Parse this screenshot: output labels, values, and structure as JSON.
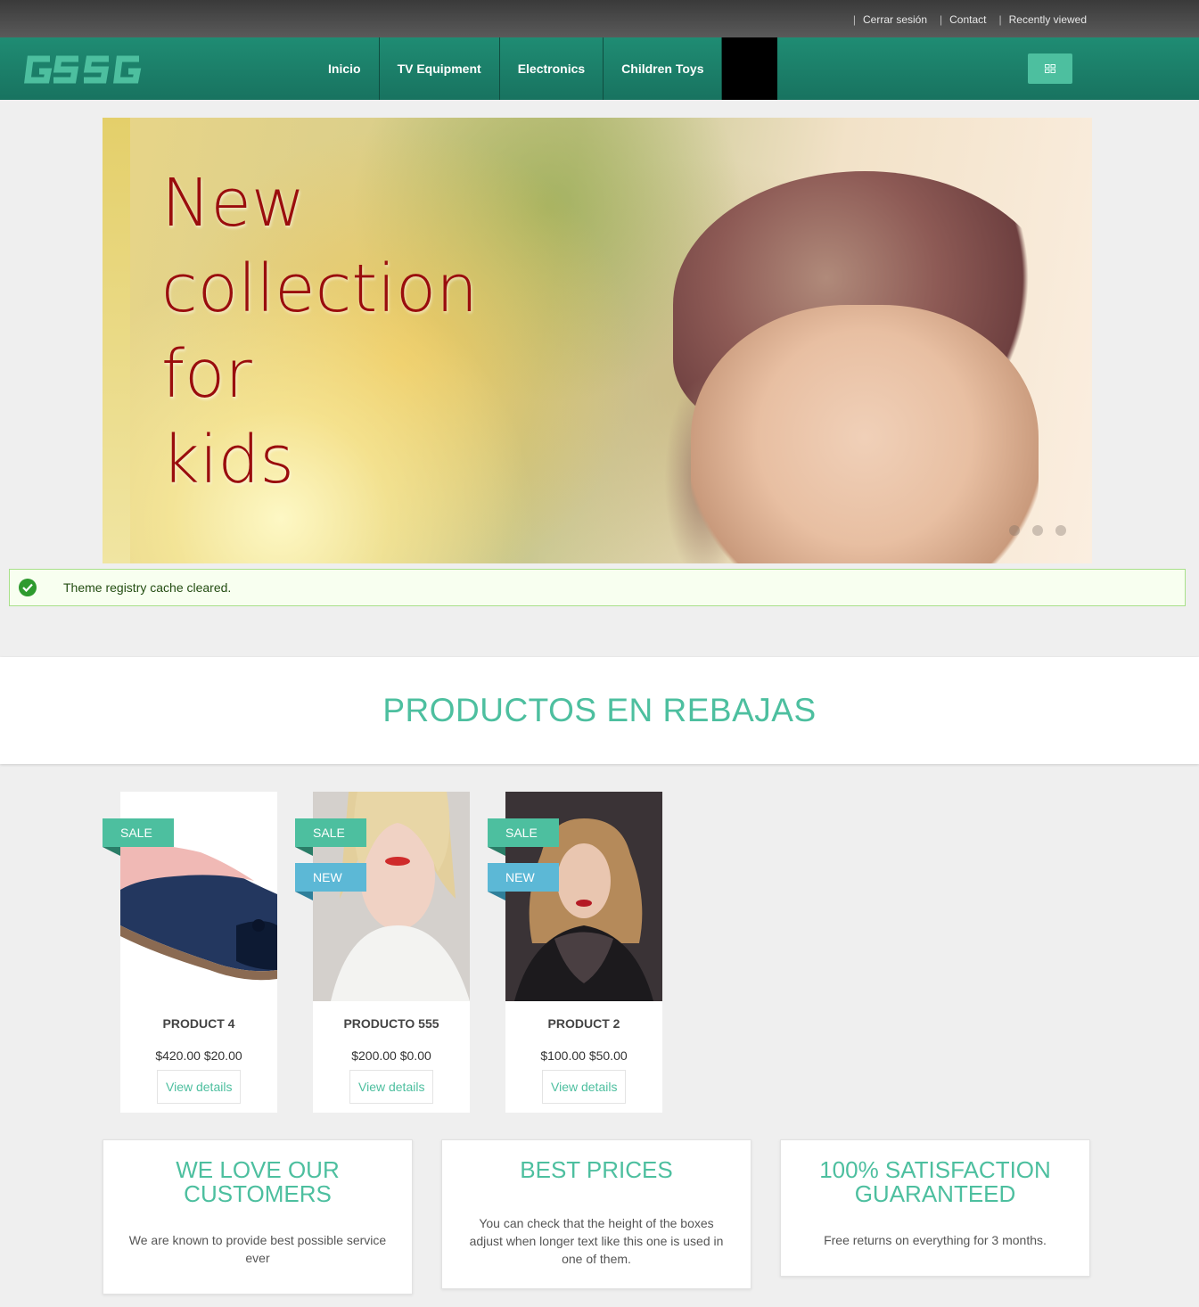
{
  "topbar": {
    "links": [
      "Cerrar sesión",
      "Contact",
      "Recently viewed"
    ]
  },
  "logo": "GSSG",
  "nav": {
    "items": [
      "Inicio",
      "TV Equipment",
      "Electronics",
      "Children Toys"
    ]
  },
  "hero": {
    "title_lines": [
      "New",
      "collection",
      "for",
      "kids"
    ]
  },
  "status": {
    "message": "Theme registry cache cleared."
  },
  "section": {
    "title": "PRODUCTOS EN REBAJAS"
  },
  "products": [
    {
      "name": "PRODUCT 4",
      "price": "$420.00 $20.00",
      "badges": [
        "SALE"
      ],
      "button": "View details"
    },
    {
      "name": "PRODUCTO 555",
      "price": "$200.00 $0.00",
      "badges": [
        "SALE",
        "NEW"
      ],
      "button": "View details"
    },
    {
      "name": "PRODUCT 2",
      "price": "$100.00 $50.00",
      "badges": [
        "SALE",
        "NEW"
      ],
      "button": "View details"
    }
  ],
  "features": [
    {
      "title": "WE LOVE OUR CUSTOMERS",
      "text": "We are known to provide best possible service ever"
    },
    {
      "title": "BEST PRICES",
      "text": "You can check that the height of the boxes adjust when longer text like this one is used in one of them."
    },
    {
      "title": "100% SATISFACTION GUARANTEED",
      "text": "Free returns on everything for 3 months."
    }
  ],
  "colors": {
    "accent": "#4dbf9f",
    "nav": "#1f8c73",
    "hero_text": "#9a0d0d",
    "new_badge": "#5cb8d6"
  }
}
